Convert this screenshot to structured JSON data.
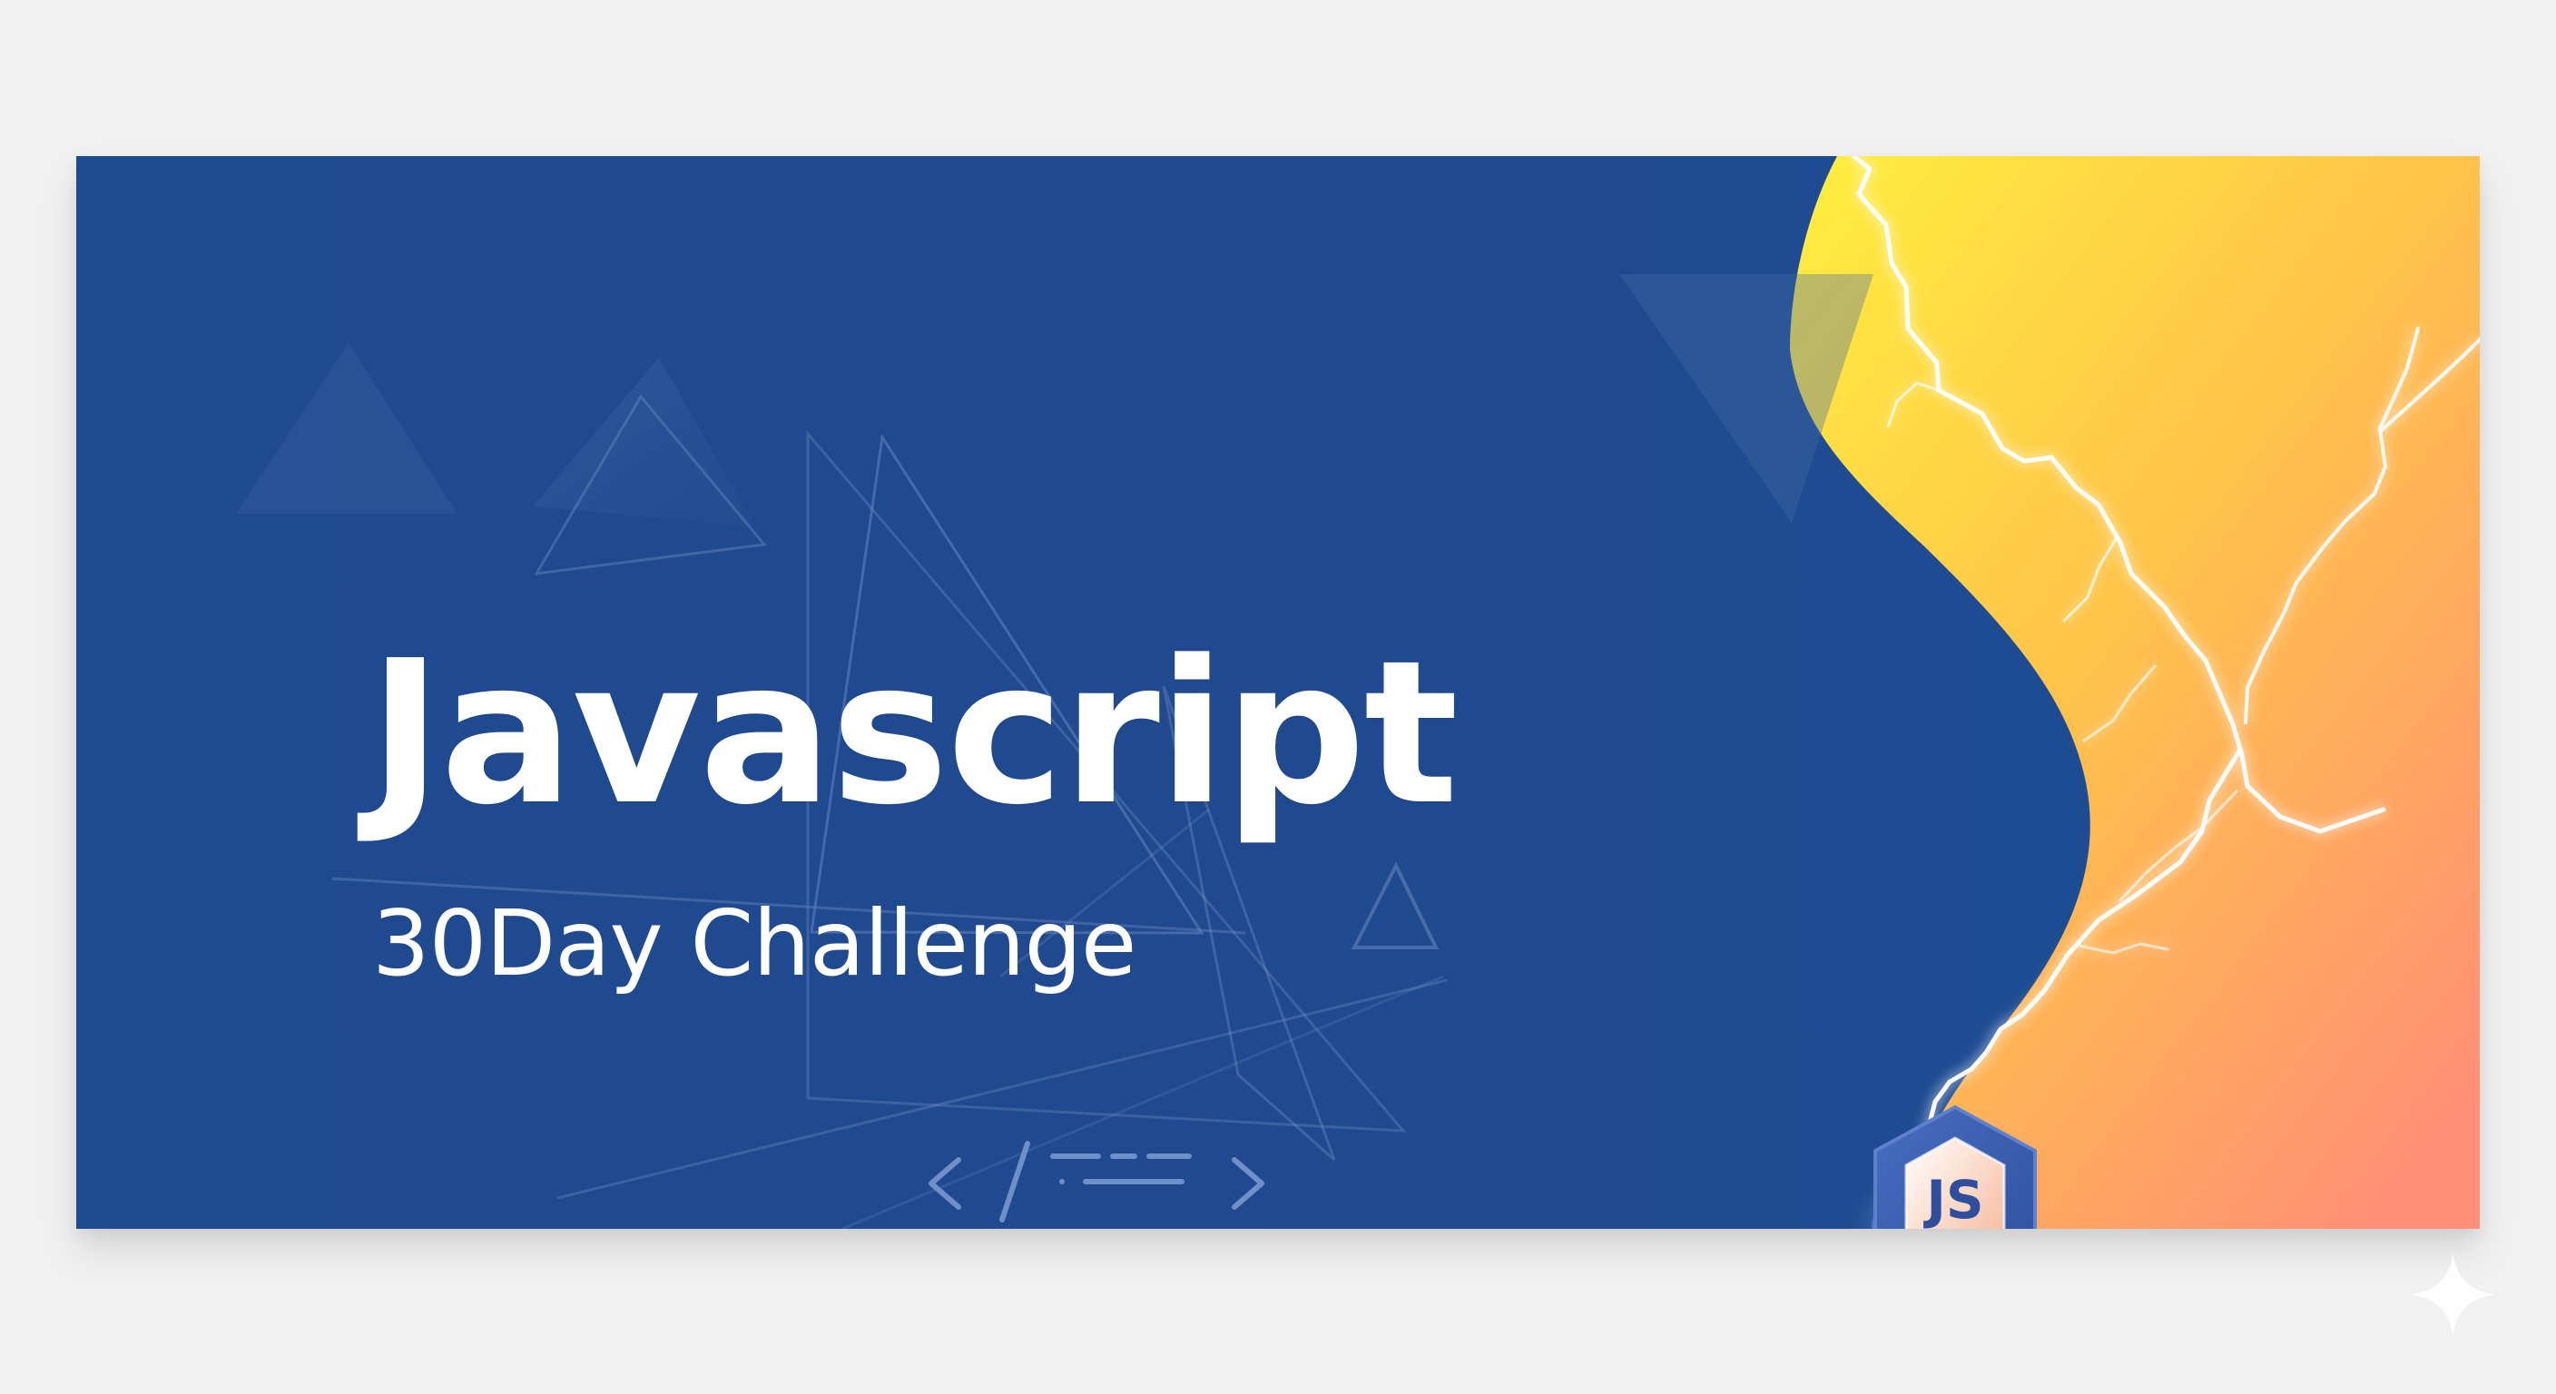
{
  "banner": {
    "title": "Javascript",
    "subtitle": "30Day Challenge"
  },
  "badge": {
    "label": "JS"
  },
  "icons": {
    "code": "code-icon",
    "badge": "js-badge-icon",
    "sparkle": "sparkle-icon"
  },
  "colors": {
    "page_background": "#f1f1f2",
    "banner_blue": "#1f4b91",
    "gradient_yellow": "#ffe83f",
    "gradient_orange": "#ffb347",
    "gradient_coral": "#ff8f73",
    "text_white": "#ffffff"
  }
}
